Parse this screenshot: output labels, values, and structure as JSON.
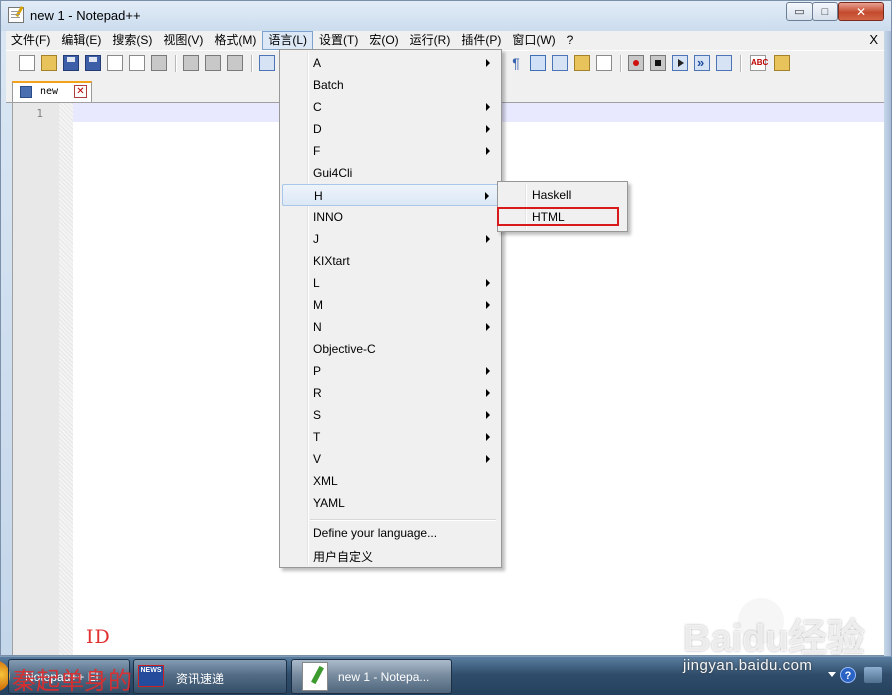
{
  "window": {
    "title": "new  1 - Notepad++",
    "min_glyph": "▭",
    "max_glyph": "□",
    "close_glyph": "✕"
  },
  "menubar": {
    "items": [
      {
        "label": "文件(F)"
      },
      {
        "label": "编辑(E)"
      },
      {
        "label": "搜索(S)"
      },
      {
        "label": "视图(V)"
      },
      {
        "label": "格式(M)"
      },
      {
        "label": "语言(L)",
        "active": true
      },
      {
        "label": "设置(T)"
      },
      {
        "label": "宏(O)"
      },
      {
        "label": "运行(R)"
      },
      {
        "label": "插件(P)"
      },
      {
        "label": "窗口(W)"
      },
      {
        "label": "?"
      }
    ],
    "close_label": "X"
  },
  "toolbar": {
    "spellcheck_label": "ABC",
    "paragraph_glyph": "¶"
  },
  "tabs": [
    {
      "label": "new",
      "close_glyph": "✕",
      "active": true
    }
  ],
  "editor": {
    "line_numbers": [
      "1"
    ],
    "overlay_mark": "ID"
  },
  "language_menu": {
    "items": [
      {
        "label": "A",
        "submenu": true
      },
      {
        "label": "Batch",
        "submenu": false
      },
      {
        "label": "C",
        "submenu": true
      },
      {
        "label": "D",
        "submenu": true
      },
      {
        "label": "F",
        "submenu": true
      },
      {
        "label": "Gui4Cli",
        "submenu": false
      },
      {
        "label": "H",
        "submenu": true,
        "highlighted": true
      },
      {
        "label": "INNO",
        "submenu": false
      },
      {
        "label": "J",
        "submenu": true
      },
      {
        "label": "KIXtart",
        "submenu": false
      },
      {
        "label": "L",
        "submenu": true
      },
      {
        "label": "M",
        "submenu": true
      },
      {
        "label": "N",
        "submenu": true
      },
      {
        "label": "Objective-C",
        "submenu": false
      },
      {
        "label": "P",
        "submenu": true
      },
      {
        "label": "R",
        "submenu": true
      },
      {
        "label": "S",
        "submenu": true
      },
      {
        "label": "T",
        "submenu": true
      },
      {
        "label": "V",
        "submenu": true
      },
      {
        "label": "XML",
        "submenu": false
      },
      {
        "label": "YAML",
        "submenu": false
      }
    ],
    "footer_items": [
      {
        "label": "Define your language..."
      },
      {
        "label": "用户自定义"
      }
    ]
  },
  "h_submenu": {
    "items": [
      {
        "label": "Haskell"
      },
      {
        "label": "HTML",
        "annotated": true
      }
    ]
  },
  "taskbar": {
    "buttons": [
      {
        "label": "Notepad++ El"
      },
      {
        "label": "资讯速递",
        "icon_text": "NEWS"
      },
      {
        "label": "new  1 - Notepa...",
        "active": true
      }
    ],
    "help_glyph": "?"
  },
  "watermarks": {
    "author": "秦起单身的",
    "baidu_logo": "Baidu经验",
    "baidu_url": "jingyan.baidu.com"
  },
  "colors": {
    "highlight_box": "#d81a1a",
    "tab_accent": "#f2a21b",
    "current_line": "#e8e8ff"
  }
}
